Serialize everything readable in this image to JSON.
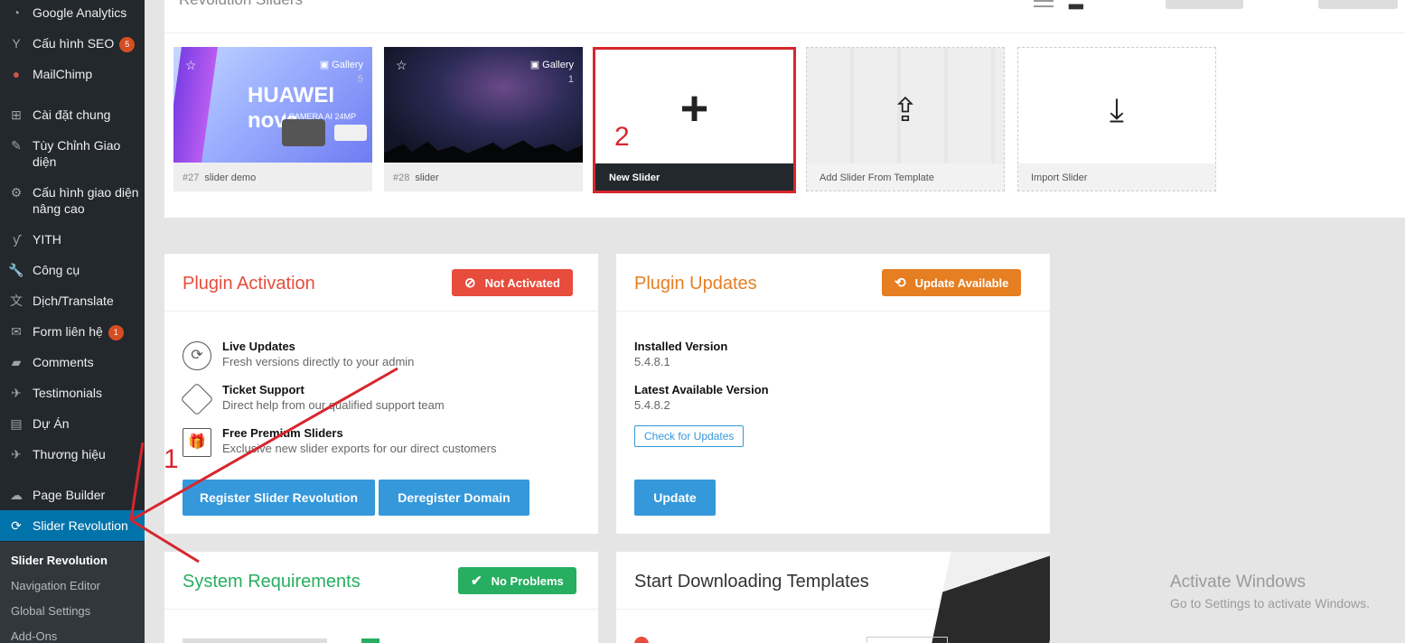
{
  "sidebar": {
    "items": [
      {
        "label": "Google Analytics",
        "icon": "chart-icon"
      },
      {
        "label": "Cấu hình SEO",
        "icon": "yoast-icon",
        "badge": "5"
      },
      {
        "label": "MailChimp",
        "icon": "mailchimp-icon"
      },
      {
        "label": "Cài đặt chung",
        "icon": "settings-icon"
      },
      {
        "label": "Tùy Chỉnh Giao diện",
        "icon": "brush-icon"
      },
      {
        "label": "Cấu hình giao diện nâng cao",
        "icon": "gear-icon"
      },
      {
        "label": "YITH",
        "icon": "yith-icon"
      },
      {
        "label": "Công cụ",
        "icon": "wrench-icon"
      },
      {
        "label": "Dịch/Translate",
        "icon": "translate-icon"
      },
      {
        "label": "Form liên hệ",
        "icon": "mail-icon",
        "badge": "1"
      },
      {
        "label": "Comments",
        "icon": "comment-icon"
      },
      {
        "label": "Testimonials",
        "icon": "pin-icon"
      },
      {
        "label": "Dự Án",
        "icon": "folder-icon"
      },
      {
        "label": "Thương hiệu",
        "icon": "pin-icon"
      },
      {
        "label": "Page Builder",
        "icon": "cloud-icon"
      },
      {
        "label": "Slider Revolution",
        "icon": "refresh-icon",
        "active": true
      }
    ],
    "submenu": [
      "Slider Revolution",
      "Navigation Editor",
      "Global Settings",
      "Add-Ons"
    ]
  },
  "slider_panel": {
    "title": "Revolution Sliders",
    "sliders": [
      {
        "id": "#27",
        "name": "slider demo",
        "type": "Gallery",
        "count": "5",
        "thumb_text": "HUAWEI nova",
        "thumb_sub": "4 CAMERA AI 24MP"
      },
      {
        "id": "#28",
        "name": "slider",
        "type": "Gallery",
        "count": "1"
      }
    ],
    "new_slider": "New Slider",
    "add_template": "Add Slider From Template",
    "import_slider": "Import Slider"
  },
  "activation": {
    "title": "Plugin Activation",
    "status": "Not Activated",
    "features": [
      {
        "title": "Live Updates",
        "desc": "Fresh versions directly to your admin"
      },
      {
        "title": "Ticket Support",
        "desc": "Direct help from our qualified support team"
      },
      {
        "title": "Free Premium Sliders",
        "desc": "Exclusive new slider exports for our direct customers"
      }
    ],
    "register_btn": "Register Slider Revolution",
    "deregister_btn": "Deregister Domain"
  },
  "updates": {
    "title": "Plugin Updates",
    "status": "Update Available",
    "installed_label": "Installed Version",
    "installed_value": "5.4.8.1",
    "latest_label": "Latest Available Version",
    "latest_value": "5.4.8.2",
    "check_btn": "Check for Updates",
    "update_btn": "Update"
  },
  "system": {
    "title": "System Requirements",
    "status": "No Problems"
  },
  "templates": {
    "title": "Start Downloading Templates"
  },
  "annotations": {
    "step1": "1",
    "step2": "2"
  },
  "watermark": {
    "line1": "Activate Windows",
    "line2": "Go to Settings to activate Windows."
  },
  "colors": {
    "red": "#e74c3c",
    "orange": "#e67e22",
    "green": "#27ae60",
    "blue": "#3498db",
    "sidebar": "#23282d",
    "active": "#0073aa"
  }
}
